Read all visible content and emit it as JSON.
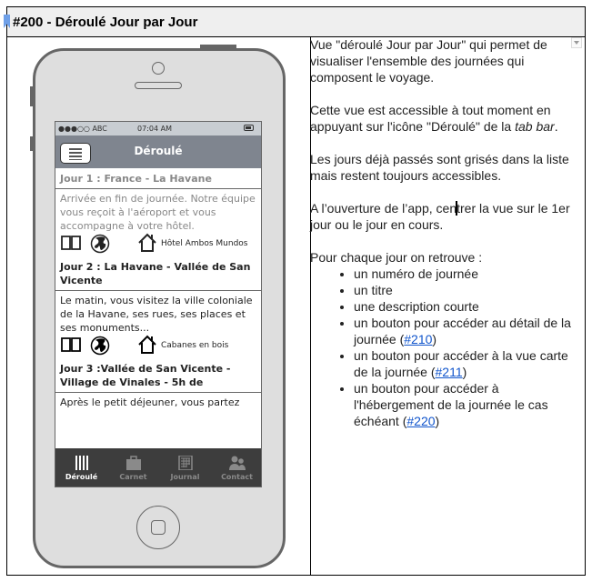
{
  "header": {
    "title": "#200 - Déroulé Jour par Jour"
  },
  "phone": {
    "status_bar": {
      "signal": "●●●○○ ABC",
      "time": "07:04 AM"
    },
    "nav_title": "Déroulé",
    "days": [
      {
        "title": "Jour 1 : France - La Havane",
        "description": "Arrivée en fin de journée. Notre équipe vous reçoit à l'aéroport et vous accompagne à votre hôtel.",
        "accommodation": "Hôtel Ambos Mundos",
        "past": true
      },
      {
        "title": "Jour 2 : La Havane - Vallée de San Vicente",
        "description": "Le matin, vous visitez la ville coloniale de la Havane, ses rues, ses places et ses monuments...",
        "accommodation": "Cabanes en bois",
        "past": false
      },
      {
        "title": "Jour 3 :Vallée de San Vicente - Village de Vinales - 5h de",
        "description": "Après le petit déjeuner, vous partez",
        "past": false
      }
    ],
    "tabs": [
      {
        "label": "Déroulé",
        "icon": "bars-icon",
        "active": true
      },
      {
        "label": "Carnet",
        "icon": "briefcase-icon",
        "active": false
      },
      {
        "label": "Journal",
        "icon": "calendar-icon",
        "active": false
      },
      {
        "label": "Contact",
        "icon": "contacts-icon",
        "active": false
      }
    ]
  },
  "description": {
    "p1": "Vue \"déroulé Jour par Jour\" qui permet de visualiser l'ensemble des journées qui composent le voyage.",
    "p2_before": "Cette vue est accessible à tout moment en appuyant sur l'icône \"Déroulé\" de la ",
    "p2_italic": "tab bar",
    "p2_after": ".",
    "p3": "Les jours déjà passés sont grisés dans la liste mais restent toujours accessibles.",
    "p4_before": "A l’ouverture de l’app, cen",
    "p4_after": "trer la vue sur le 1er jour ou le jour en cours.",
    "p5": "Pour chaque jour on retrouve :",
    "bullets": [
      {
        "text": "un numéro de journée"
      },
      {
        "text": "un titre"
      },
      {
        "text": "une description courte"
      },
      {
        "text": "un bouton pour accéder au détail de la journée (",
        "link": "#210",
        "after": ")"
      },
      {
        "text": "un bouton pour accéder à la vue carte de la journée (",
        "link": "#211",
        "after": ")"
      },
      {
        "text": "un bouton pour accéder à l'hébergement de la journée le cas échéant (",
        "link": "#220",
        "after": ")"
      }
    ]
  },
  "colors": {
    "link": "#1155cc",
    "header_bg": "#efefef",
    "bookmark": "#6fa0e8"
  }
}
